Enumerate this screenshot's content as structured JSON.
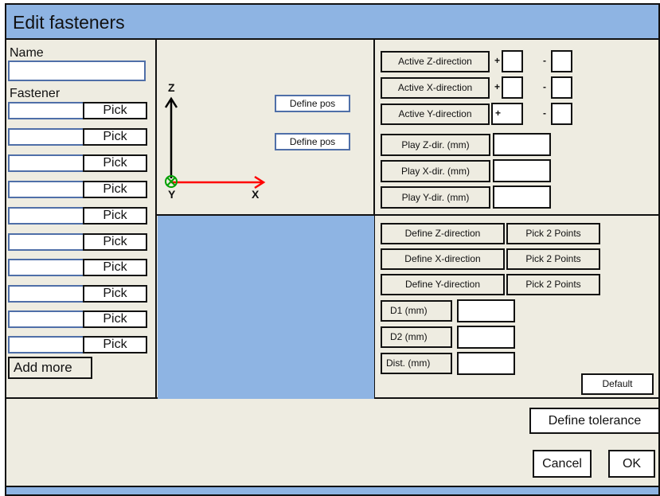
{
  "window": {
    "title": "Edit fasteners"
  },
  "left_panel": {
    "name_label": "Name",
    "name_value": "",
    "fastener_label": "Fastener",
    "fastener_rows": [
      {
        "value": "",
        "pick_label": "Pick"
      },
      {
        "value": "",
        "pick_label": "Pick"
      },
      {
        "value": "",
        "pick_label": "Pick"
      },
      {
        "value": "",
        "pick_label": "Pick"
      },
      {
        "value": "",
        "pick_label": "Pick"
      },
      {
        "value": "",
        "pick_label": "Pick"
      },
      {
        "value": "",
        "pick_label": "Pick"
      },
      {
        "value": "",
        "pick_label": "Pick"
      },
      {
        "value": "",
        "pick_label": "Pick"
      },
      {
        "value": "",
        "pick_label": "Pick"
      }
    ],
    "add_more_label": "Add more"
  },
  "axis_view": {
    "z_label": "Z",
    "x_label": "X",
    "y_label": "Y",
    "define_pos_1": "Define pos",
    "define_pos_2": "Define pos",
    "colors": {
      "z_axis": "#000000",
      "x_axis": "#ff0000",
      "y_marker": "#00a000"
    }
  },
  "direction_panel": {
    "active_z": "Active Z-direction",
    "active_x": "Active X-direction",
    "active_y": "Active Y-direction",
    "plus": "+",
    "minus": "-",
    "play_z": "Play Z-dir. (mm)",
    "play_x": "Play X-dir. (mm)",
    "play_y": "Play Y-dir. (mm)",
    "play_z_value": "",
    "play_x_value": "",
    "play_y_value": ""
  },
  "define_panel": {
    "define_z": "Define Z-direction",
    "define_x": "Define X-direction",
    "define_y": "Define Y-direction",
    "pick_2_points": "Pick 2 Points",
    "d1": "D1 (mm)",
    "d2": "D2 (mm)",
    "dist": "Dist. (mm)",
    "d1_value": "",
    "d2_value": "",
    "dist_value": "",
    "default_label": "Default"
  },
  "footer": {
    "define_tolerance": "Define tolerance",
    "cancel": "Cancel",
    "ok": "OK"
  },
  "colors": {
    "title_bg": "#8eb4e3",
    "panel_bg": "#eeece1",
    "blue_pane": "#8eb4e3"
  }
}
